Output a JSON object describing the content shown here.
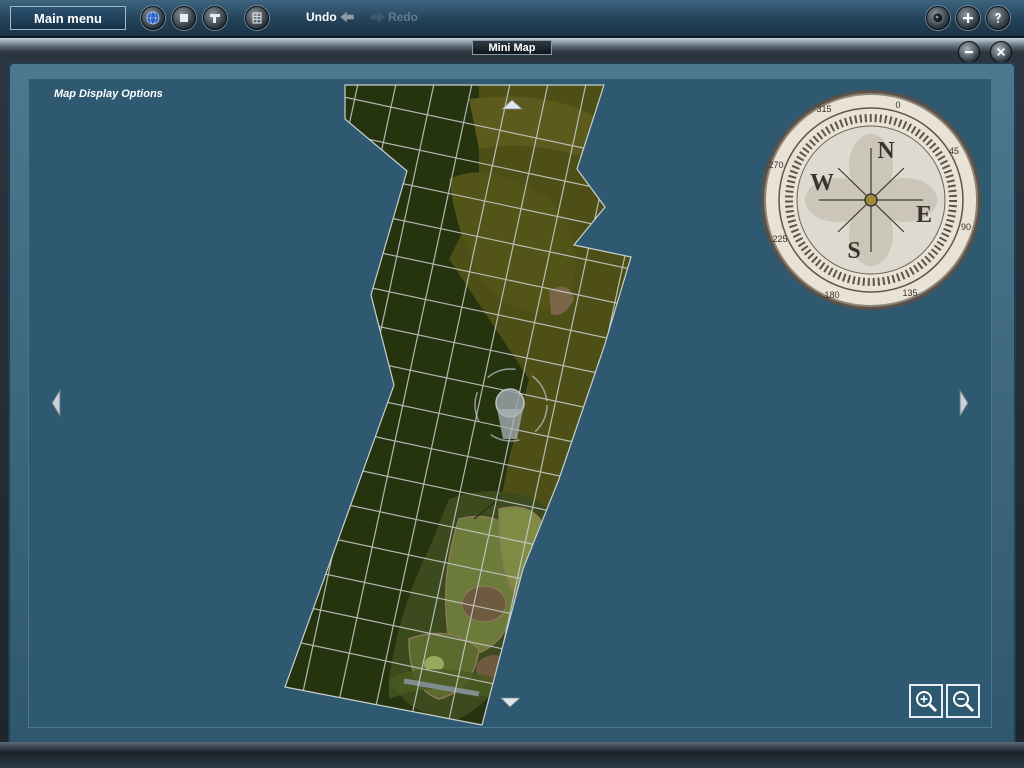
{
  "toolbar": {
    "main_menu_label": "Main menu",
    "undo_label": "Undo",
    "redo_label": "Redo",
    "left_icons": [
      "globe-icon",
      "stop-icon",
      "tool-icon",
      "grid-icon"
    ],
    "right_icons": [
      "camera-icon",
      "add-icon",
      "help-icon"
    ]
  },
  "panel": {
    "title": "Mini Map",
    "options_label": "Map Display Options",
    "minimize_icon": "minus-icon",
    "close_icon": "close-icon"
  },
  "compass": {
    "cardinals": [
      "N",
      "E",
      "S",
      "W"
    ],
    "degree_labels": [
      "0",
      "45",
      "90",
      "135",
      "180",
      "225",
      "270",
      "315"
    ]
  },
  "zoom": {
    "in_icon": "zoom-in-icon",
    "out_icon": "zoom-out-icon"
  },
  "colors": {
    "background": "#2e5970",
    "terrain_dark": "#2a3612",
    "terrain_light": "#56561b",
    "grid": "#c8ced0",
    "toolbar": "#234258"
  }
}
